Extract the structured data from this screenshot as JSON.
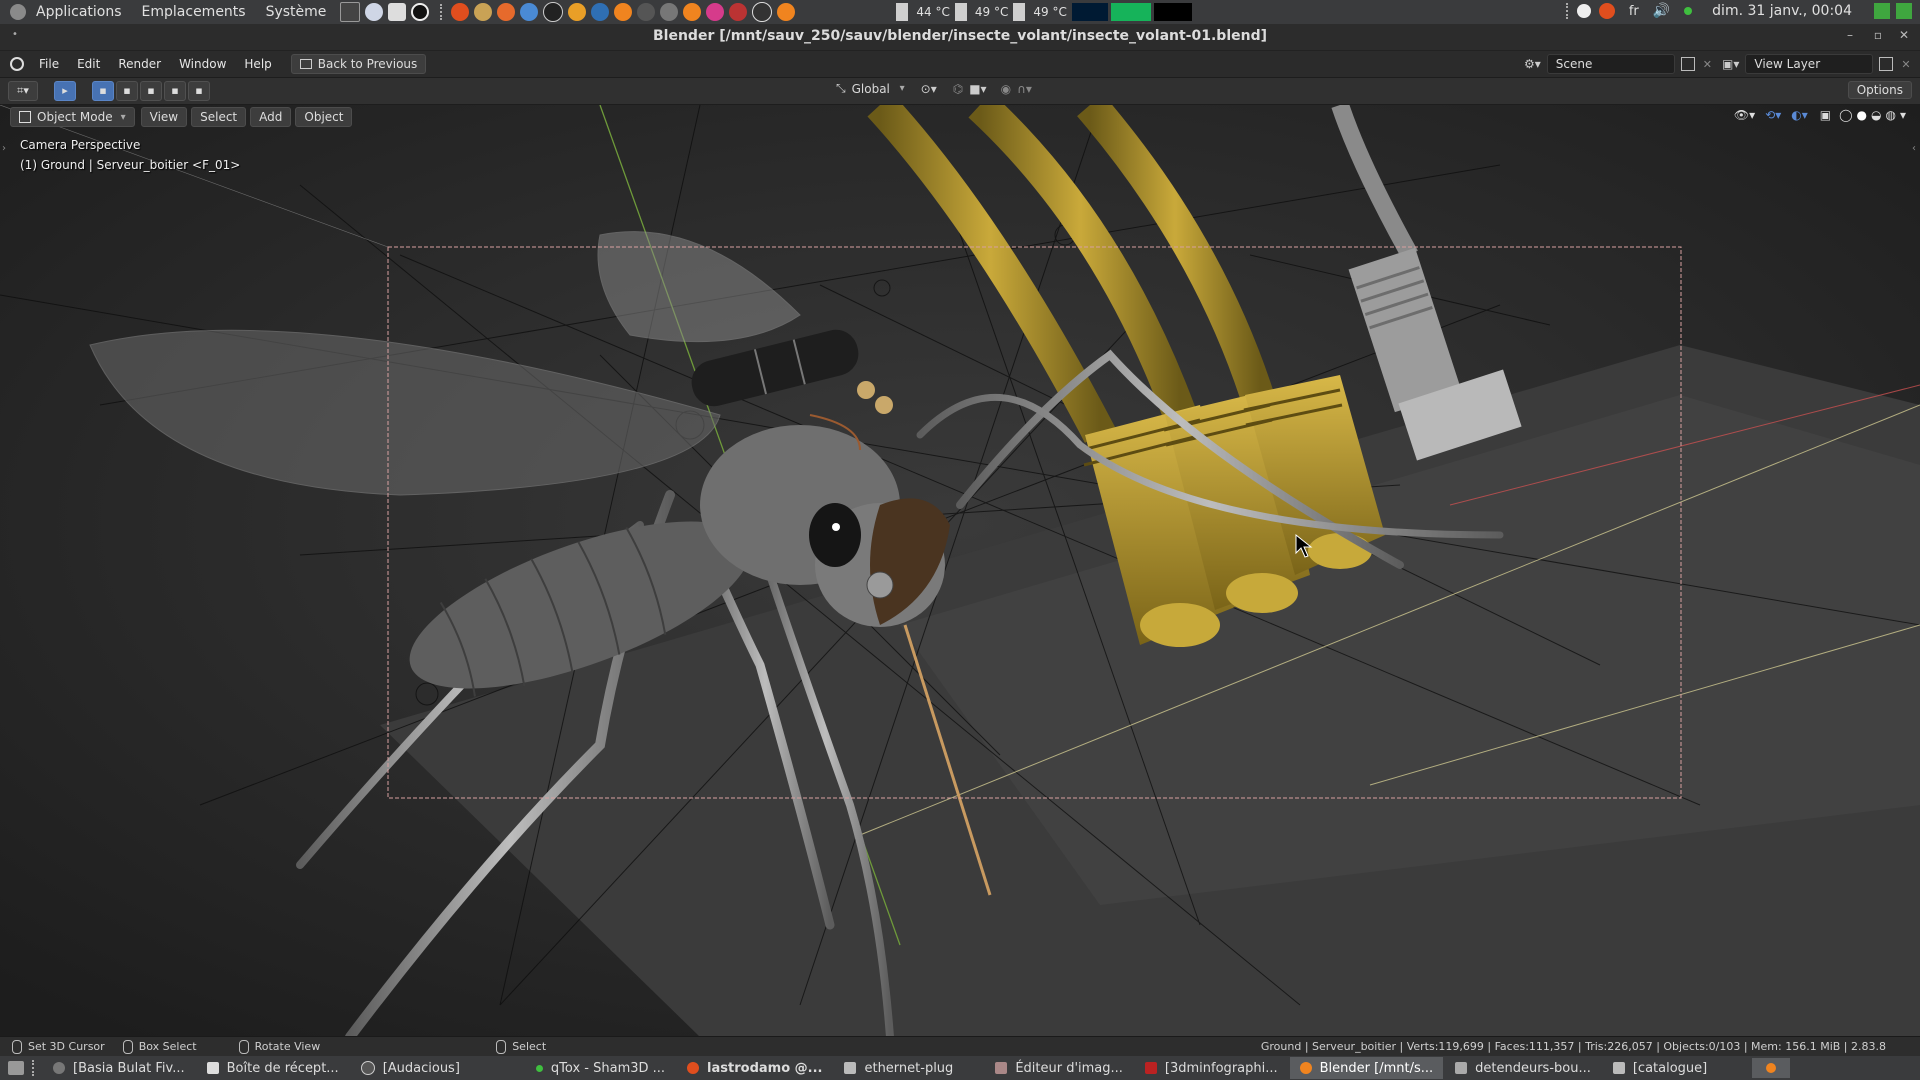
{
  "system_panel": {
    "menus": [
      "Applications",
      "Emplacements",
      "Système"
    ],
    "temperatures": [
      "44 °C",
      "49 °C",
      "49 °C"
    ],
    "language": "fr",
    "datetime": "dim. 31 janv., 00:04"
  },
  "window": {
    "title": "Blender [/mnt/sauv_250/sauv/blender/insecte_volant/insecte_volant-01.blend]"
  },
  "blender": {
    "menu": [
      "File",
      "Edit",
      "Render",
      "Window",
      "Help"
    ],
    "back_button": "Back to Previous",
    "scene": "Scene",
    "view_layer": "View Layer"
  },
  "tool_header": {
    "orientation": "Global",
    "options": "Options"
  },
  "viewport_header": {
    "mode": "Object Mode",
    "menu": [
      "View",
      "Select",
      "Add",
      "Object"
    ]
  },
  "viewport": {
    "camera_label": "Camera Perspective",
    "object_label": "(1) Ground | Serveur_boitier <F_01>"
  },
  "status_bar": {
    "hints": [
      "Set 3D Cursor",
      "Box Select",
      "Rotate View",
      "Select"
    ],
    "stats": "Ground | Serveur_boitier | Verts:119,699 | Faces:111,357 | Tris:226,057 | Objects:0/103 | Mem: 156.1 MiB | 2.83.8"
  },
  "taskbar": {
    "items": [
      {
        "label": "[Basia Bulat Fiv...",
        "active": false
      },
      {
        "label": "Boîte de récept...",
        "active": false
      },
      {
        "label": "[Audacious]",
        "active": false
      },
      {
        "label": "qTox - Sham3D ...",
        "active": false
      },
      {
        "label": "lastrodamo @...",
        "active": false
      },
      {
        "label": "ethernet-plug",
        "active": false
      },
      {
        "label": "Éditeur d'imag...",
        "active": false
      },
      {
        "label": "[3dminfographi...",
        "active": false
      },
      {
        "label": "Blender [/mnt/s...",
        "active": true
      },
      {
        "label": "detendeurs-bou...",
        "active": false
      },
      {
        "label": "[catalogue]",
        "active": false
      }
    ]
  },
  "colors": {
    "accent": "#4772b3",
    "camera_frame": "#d8a0a0",
    "cable": "#b89a2e"
  }
}
